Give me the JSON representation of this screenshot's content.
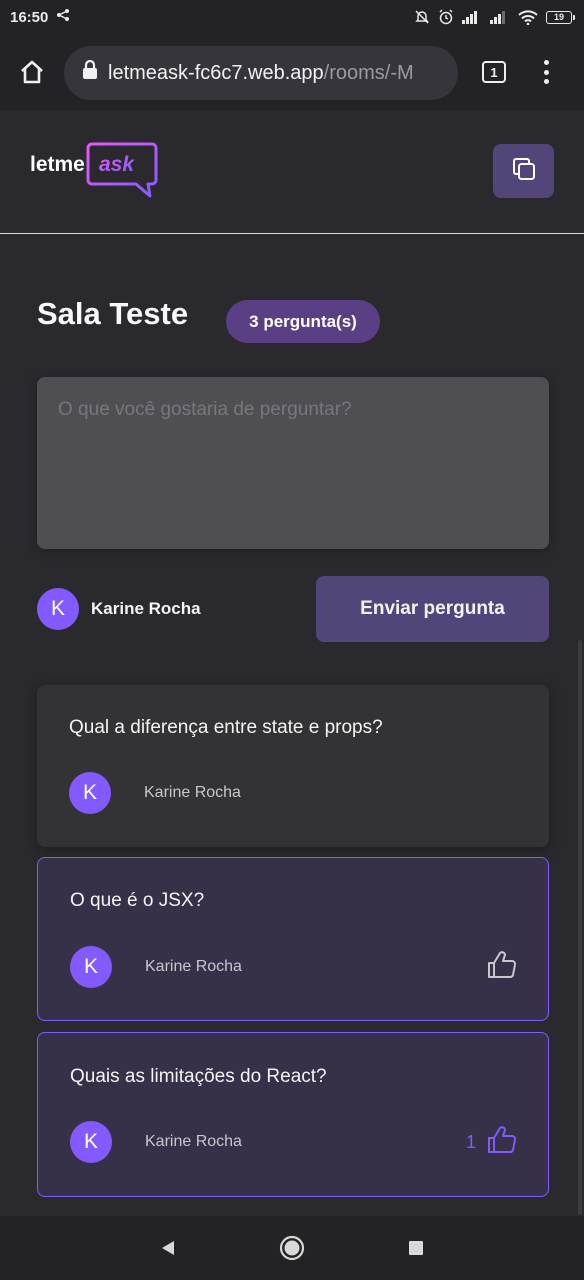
{
  "status_bar": {
    "time": "16:50",
    "battery": "19",
    "icons": [
      "share-icon",
      "mute-icon",
      "alarm-icon",
      "signal-icon",
      "signal-icon",
      "wifi-icon",
      "battery-icon"
    ]
  },
  "browser": {
    "url_domain": "letmeask-fc6c7.web.app",
    "url_path": "/rooms/-M",
    "tab_count": "1"
  },
  "header": {
    "logo_text_a": "letme",
    "logo_text_b": "ask"
  },
  "room": {
    "title": "Sala Teste",
    "question_count": "3 pergunta(s)",
    "input_placeholder": "O que você gostaria de perguntar?",
    "input_value": "",
    "user_initial": "K",
    "user_name": "Karine Rocha",
    "send_label": "Enviar pergunta"
  },
  "questions": [
    {
      "text": "Qual a diferença entre state e props?",
      "author_initial": "K",
      "author": "Karine Rocha",
      "highlighted": false,
      "likes": ""
    },
    {
      "text": "O que é o JSX?",
      "author_initial": "K",
      "author": "Karine Rocha",
      "highlighted": true,
      "likes": ""
    },
    {
      "text": "Quais as limitações do React?",
      "author_initial": "K",
      "author": "Karine Rocha",
      "highlighted": true,
      "likes": "1"
    }
  ],
  "colors": {
    "accent": "#835afd",
    "button": "#52457a",
    "badge": "#5a3f85",
    "logo_gradient": [
      "#e559f9",
      "#835afd"
    ]
  }
}
